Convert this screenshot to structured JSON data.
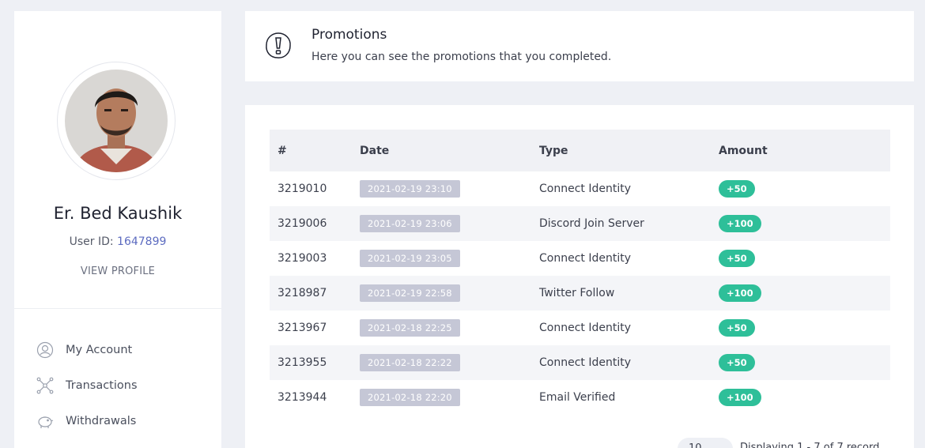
{
  "profile": {
    "name": "Er. Bed Kaushik",
    "user_id_label": "User ID:",
    "user_id": "1647899",
    "view_profile": "VIEW PROFILE"
  },
  "nav": {
    "items": [
      {
        "label": "My Account",
        "icon": "user-circle-icon"
      },
      {
        "label": "Transactions",
        "icon": "network-icon"
      },
      {
        "label": "Withdrawals",
        "icon": "piggy-bank-icon"
      }
    ]
  },
  "promo": {
    "title": "Promotions",
    "subtitle": "Here you can see the promotions that you completed.",
    "icon": "exclamation-circle-icon"
  },
  "table": {
    "headers": [
      "#",
      "Date",
      "Type",
      "Amount"
    ],
    "rows": [
      {
        "id": "3219010",
        "date": "2021-02-19 23:10",
        "type": "Connect Identity",
        "amount": "+50"
      },
      {
        "id": "3219006",
        "date": "2021-02-19 23:06",
        "type": "Discord Join Server",
        "amount": "+100"
      },
      {
        "id": "3219003",
        "date": "2021-02-19 23:05",
        "type": "Connect Identity",
        "amount": "+50"
      },
      {
        "id": "3218987",
        "date": "2021-02-19 22:58",
        "type": "Twitter Follow",
        "amount": "+100"
      },
      {
        "id": "3213967",
        "date": "2021-02-18 22:25",
        "type": "Connect Identity",
        "amount": "+50"
      },
      {
        "id": "3213955",
        "date": "2021-02-18 22:22",
        "type": "Connect Identity",
        "amount": "+50"
      },
      {
        "id": "3213944",
        "date": "2021-02-18 22:20",
        "type": "Email Verified",
        "amount": "+100"
      }
    ]
  },
  "pagination": {
    "page_size": "10",
    "displaying": "Displaying 1 - 7 of 7 record"
  },
  "colors": {
    "accent_link": "#5c6bc0",
    "amount_badge": "#2ebf99",
    "date_badge": "#c5c7d6",
    "page_bg": "#eef0f5"
  }
}
